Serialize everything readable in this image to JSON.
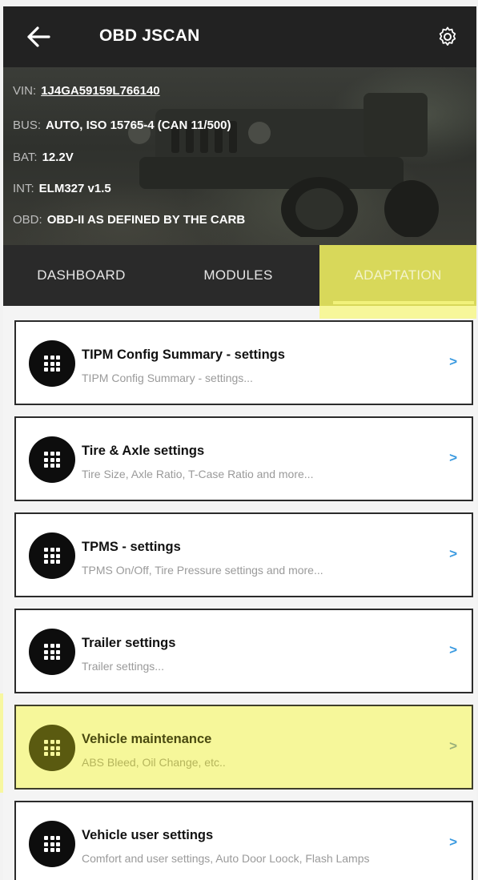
{
  "app": {
    "title": "OBD JSCAN",
    "icons": {
      "back": "arrow-left-icon",
      "settings": "gear-icon"
    },
    "colors": {
      "appbar": "#222222",
      "highlight": "#f6f79a",
      "chevron": "#3a9ae0",
      "icon_circle": "#0d0d0d"
    }
  },
  "vehicle": {
    "vin_label": "VIN:",
    "vin_value": "1J4GA59159L766140",
    "bus_label": "BUS:",
    "bus_value": "AUTO, ISO 15765-4 (CAN 11/500)",
    "bat_label": "BAT:",
    "bat_value": "12.2V",
    "int_label": "INT:",
    "int_value": "ELM327 v1.5",
    "obd_label": "OBD:",
    "obd_value": "OBD-II AS DEFINED BY THE CARB"
  },
  "tabs": [
    {
      "label": "DASHBOARD",
      "selected": false
    },
    {
      "label": "MODULES",
      "selected": false
    },
    {
      "label": "ADAPTATION",
      "selected": true
    }
  ],
  "items": [
    {
      "title": "TIPM Config Summary - settings",
      "subtitle": "TIPM Config Summary - settings...",
      "icon": "grid-icon",
      "chevron": ">"
    },
    {
      "title": "Tire & Axle settings",
      "subtitle": "Tire Size, Axle Ratio, T-Case Ratio and more...",
      "icon": "grid-icon",
      "chevron": ">"
    },
    {
      "title": "TPMS - settings",
      "subtitle": "TPMS On/Off, Tire Pressure settings and more...",
      "icon": "grid-icon",
      "chevron": ">"
    },
    {
      "title": "Trailer settings",
      "subtitle": "Trailer settings...",
      "icon": "grid-icon",
      "chevron": ">"
    },
    {
      "title": "Vehicle maintenance",
      "subtitle": "ABS Bleed, Oil Change, etc..",
      "icon": "grid-icon",
      "chevron": ">",
      "highlighted": true
    },
    {
      "title": "Vehicle user settings",
      "subtitle": "Comfort and user settings, Auto Door Loock, Flash Lamps",
      "icon": "grid-icon",
      "chevron": ">"
    }
  ]
}
